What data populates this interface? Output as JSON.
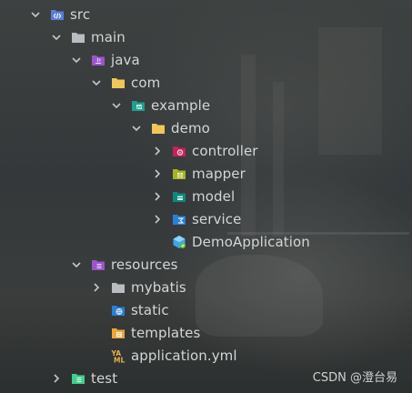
{
  "tree": {
    "nodes": [
      {
        "label": "src",
        "icon": "source-folder-icon",
        "expanded": true
      },
      {
        "label": "main",
        "icon": "folder-icon",
        "expanded": true
      },
      {
        "label": "java",
        "icon": "java-sources-folder-icon",
        "expanded": true
      },
      {
        "label": "com",
        "icon": "package-folder-icon",
        "expanded": true
      },
      {
        "label": "example",
        "icon": "package-folder-icon",
        "expanded": true
      },
      {
        "label": "demo",
        "icon": "package-folder-icon",
        "expanded": true
      },
      {
        "label": "controller",
        "icon": "controller-package-icon",
        "expanded": false
      },
      {
        "label": "mapper",
        "icon": "mapper-package-icon",
        "expanded": false
      },
      {
        "label": "model",
        "icon": "model-package-icon",
        "expanded": false
      },
      {
        "label": "service",
        "icon": "service-package-icon",
        "expanded": false
      },
      {
        "label": "DemoApplication",
        "icon": "spring-boot-class-icon"
      },
      {
        "label": "resources",
        "icon": "resources-folder-icon",
        "expanded": true
      },
      {
        "label": "mybatis",
        "icon": "folder-icon",
        "expanded": false
      },
      {
        "label": "static",
        "icon": "web-folder-icon"
      },
      {
        "label": "templates",
        "icon": "templates-folder-icon"
      },
      {
        "label": "application.yml",
        "icon": "yaml-file-icon"
      },
      {
        "label": "test",
        "icon": "test-folder-icon",
        "expanded": false
      }
    ]
  },
  "watermark": "CSDN @澄台易",
  "colors": {
    "text": "#d4d6d6",
    "chevron": "#c5c7c7",
    "folder_gray": "#b9bcc0",
    "folder_yellow": "#f0c65a",
    "java_purple": "#9a55c9",
    "test_green": "#3fcf8e"
  }
}
